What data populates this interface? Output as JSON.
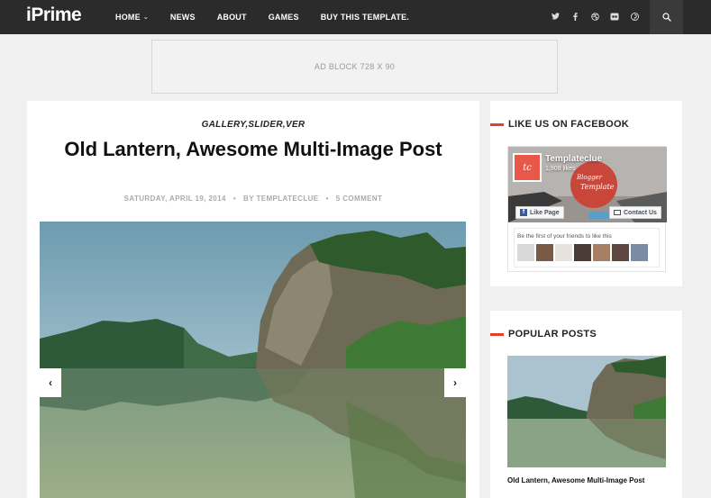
{
  "header": {
    "logo": "iPrime",
    "nav": [
      {
        "label": "HOME",
        "has_dropdown": true
      },
      {
        "label": "NEWS",
        "has_dropdown": false
      },
      {
        "label": "ABOUT",
        "has_dropdown": false
      },
      {
        "label": "GAMES",
        "has_dropdown": false
      },
      {
        "label": "BUY THIS TEMPLATE.",
        "has_dropdown": false
      }
    ],
    "social_icons": [
      "twitter-icon",
      "facebook-icon",
      "dribbble-icon",
      "flickr-icon",
      "pinterest-icon"
    ],
    "search_icon": "search-icon"
  },
  "ad": {
    "label": "AD BLOCK 728 X 90"
  },
  "post": {
    "categories": "GALLERY,SLIDER,VER",
    "title": "Old Lantern, Awesome Multi-Image Post",
    "date": "SATURDAY, APRIL 19, 2014",
    "author": "BY TEMPLATECLUE",
    "comments": "5 COMMENT",
    "prev_glyph": "‹",
    "next_glyph": "›"
  },
  "sidebar": {
    "facebook_widget": {
      "title": "LIKE US ON FACEBOOK",
      "page_name": "Templateclue",
      "likes": "1,908 likes",
      "logo_text": "tc",
      "cover_text_1": "Blogger",
      "cover_text_2": "Template",
      "like_button": "Like Page",
      "contact_button": "Contact Us",
      "friends_text": "Be the first of your friends to like this"
    },
    "popular_posts": {
      "title": "POPULAR POSTS",
      "items": [
        {
          "title": "Old Lantern, Awesome Multi-Image Post"
        }
      ]
    }
  },
  "colors": {
    "topbar": "#2b2b2b",
    "accent": "#e0402d",
    "facebook_blue": "#3b5998",
    "background": "#f0f0f0"
  }
}
